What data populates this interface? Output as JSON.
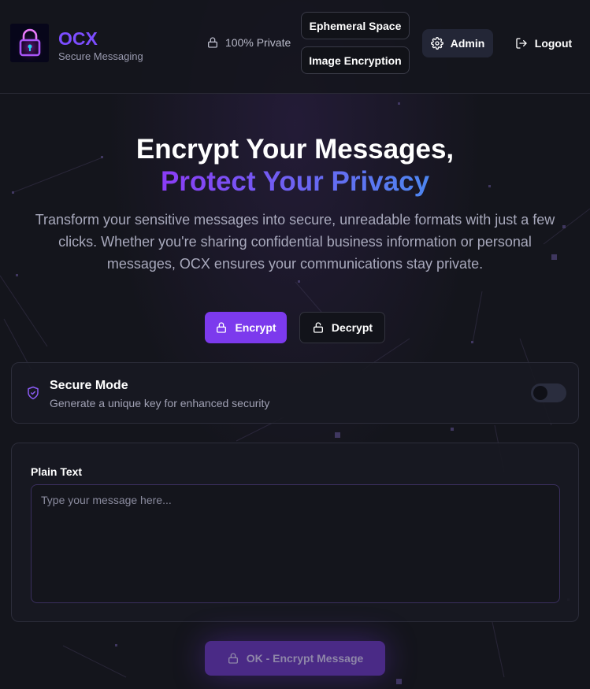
{
  "brand": {
    "name": "OCX",
    "tagline": "Secure Messaging",
    "logo_icon": "neon-padlock-icon"
  },
  "header": {
    "privacy_badge": "100% Private",
    "nav": {
      "ephemeral": "Ephemeral Space",
      "image_encryption": "Image Encryption"
    },
    "admin_label": "Admin",
    "logout_label": "Logout"
  },
  "hero": {
    "title_line1": "Encrypt Your Messages,",
    "title_line2": "Protect Your Privacy",
    "description": "Transform your sensitive messages into secure, unreadable formats with just a few clicks. Whether you're sharing confidential business information or personal messages, OCX ensures your communications stay private."
  },
  "modes": {
    "encrypt_label": "Encrypt",
    "decrypt_label": "Decrypt",
    "active": "Encrypt"
  },
  "secure_mode": {
    "title": "Secure Mode",
    "subtitle": "Generate a unique key for enhanced security",
    "enabled": false
  },
  "plain_text": {
    "label": "Plain Text",
    "placeholder": "Type your message here...",
    "value": ""
  },
  "submit": {
    "label": "OK - Encrypt Message",
    "disabled": true
  },
  "colors": {
    "accent": "#7c3aed",
    "brand": "#7c4dff",
    "background": "#14151c",
    "gradient_start": "#8b3cf6",
    "gradient_end": "#4d86f0"
  }
}
